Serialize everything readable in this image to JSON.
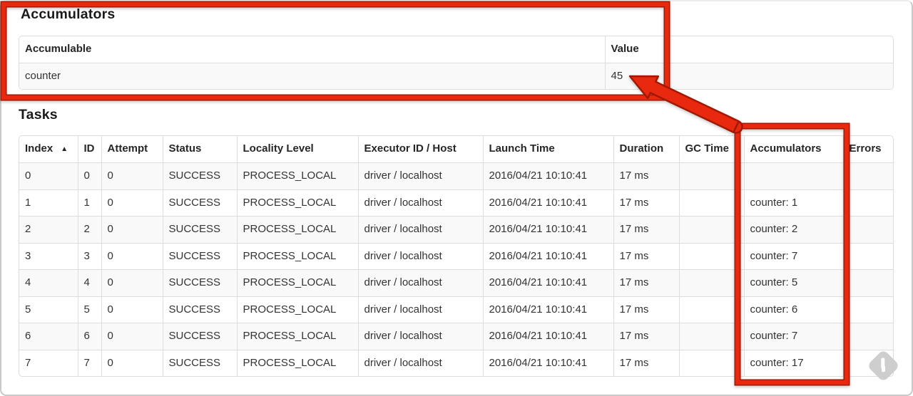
{
  "accumulators_section": {
    "heading": "Accumulators",
    "headers": {
      "accumulable": "Accumulable",
      "value": "Value"
    },
    "rows": [
      {
        "accumulable": "counter",
        "value": "45"
      }
    ]
  },
  "tasks_section": {
    "heading": "Tasks",
    "sort_indicator": "▲",
    "headers": {
      "index": "Index",
      "id": "ID",
      "attempt": "Attempt",
      "status": "Status",
      "locality": "Locality Level",
      "executor": "Executor ID / Host",
      "launch": "Launch Time",
      "duration": "Duration",
      "gc": "GC Time",
      "accumulators": "Accumulators",
      "errors": "Errors"
    },
    "rows": [
      {
        "index": "0",
        "id": "0",
        "attempt": "0",
        "status": "SUCCESS",
        "locality": "PROCESS_LOCAL",
        "executor": "driver / localhost",
        "launch": "2016/04/21 10:10:41",
        "duration": "17 ms",
        "gc": "",
        "accumulators": "",
        "errors": ""
      },
      {
        "index": "1",
        "id": "1",
        "attempt": "0",
        "status": "SUCCESS",
        "locality": "PROCESS_LOCAL",
        "executor": "driver / localhost",
        "launch": "2016/04/21 10:10:41",
        "duration": "17 ms",
        "gc": "",
        "accumulators": "counter: 1",
        "errors": ""
      },
      {
        "index": "2",
        "id": "2",
        "attempt": "0",
        "status": "SUCCESS",
        "locality": "PROCESS_LOCAL",
        "executor": "driver / localhost",
        "launch": "2016/04/21 10:10:41",
        "duration": "17 ms",
        "gc": "",
        "accumulators": "counter: 2",
        "errors": ""
      },
      {
        "index": "3",
        "id": "3",
        "attempt": "0",
        "status": "SUCCESS",
        "locality": "PROCESS_LOCAL",
        "executor": "driver / localhost",
        "launch": "2016/04/21 10:10:41",
        "duration": "17 ms",
        "gc": "",
        "accumulators": "counter: 7",
        "errors": ""
      },
      {
        "index": "4",
        "id": "4",
        "attempt": "0",
        "status": "SUCCESS",
        "locality": "PROCESS_LOCAL",
        "executor": "driver / localhost",
        "launch": "2016/04/21 10:10:41",
        "duration": "17 ms",
        "gc": "",
        "accumulators": "counter: 5",
        "errors": ""
      },
      {
        "index": "5",
        "id": "5",
        "attempt": "0",
        "status": "SUCCESS",
        "locality": "PROCESS_LOCAL",
        "executor": "driver / localhost",
        "launch": "2016/04/21 10:10:41",
        "duration": "17 ms",
        "gc": "",
        "accumulators": "counter: 6",
        "errors": ""
      },
      {
        "index": "6",
        "id": "6",
        "attempt": "0",
        "status": "SUCCESS",
        "locality": "PROCESS_LOCAL",
        "executor": "driver / localhost",
        "launch": "2016/04/21 10:10:41",
        "duration": "17 ms",
        "gc": "",
        "accumulators": "counter: 7",
        "errors": ""
      },
      {
        "index": "7",
        "id": "7",
        "attempt": "0",
        "status": "SUCCESS",
        "locality": "PROCESS_LOCAL",
        "executor": "driver / localhost",
        "launch": "2016/04/21 10:10:41",
        "duration": "17 ms",
        "gc": "",
        "accumulators": "counter: 17",
        "errors": ""
      }
    ]
  },
  "annotations": {
    "highlight_color": "#e8290f",
    "outline_color": "#a21903"
  }
}
